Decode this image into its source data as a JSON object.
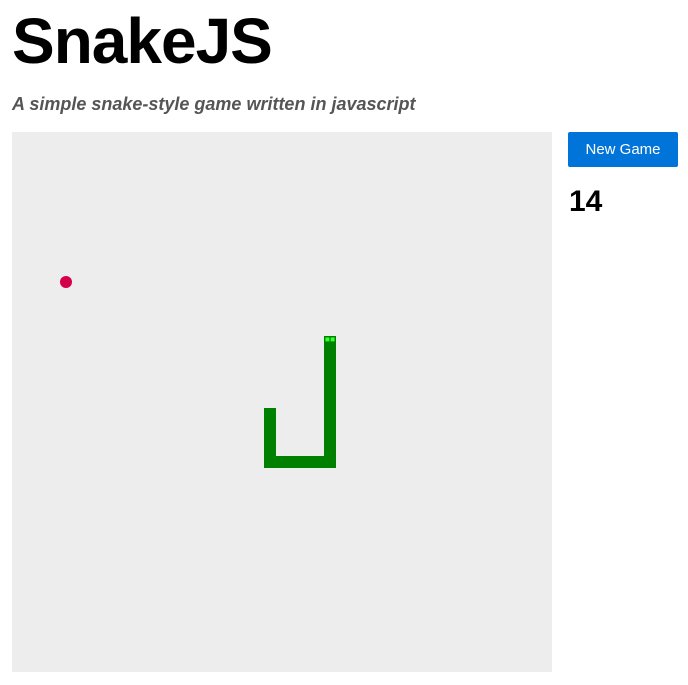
{
  "header": {
    "title": "SnakeJS",
    "subtitle": "A simple snake-style game written in javascript"
  },
  "controls": {
    "new_game_label": "New Game"
  },
  "score": "14",
  "game": {
    "grid_cells": 45,
    "food": {
      "col": 4,
      "row": 12
    },
    "snake": {
      "head": {
        "col": 26,
        "row": 17
      },
      "path": [
        {
          "col": 26,
          "row": 17
        },
        {
          "col": 26,
          "row": 27
        },
        {
          "col": 21,
          "row": 27
        },
        {
          "col": 21,
          "row": 23
        }
      ]
    }
  },
  "colors": {
    "board_background": "#ededed",
    "snake_body": "#008000",
    "snake_head": "#008000",
    "snake_eyes": "#33ff33",
    "food": "#d4004c",
    "button_background": "#0074d9",
    "button_text": "#ffffff",
    "subtitle_text": "#555555"
  }
}
